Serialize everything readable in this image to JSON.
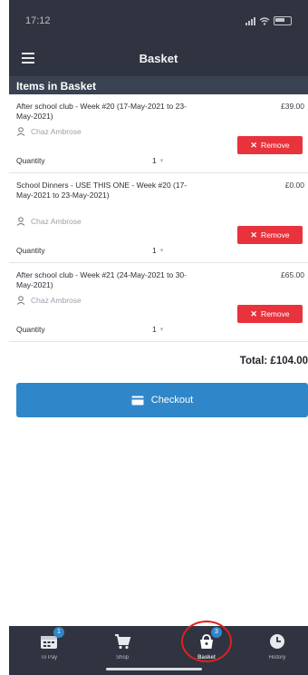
{
  "status": {
    "time": "17:12"
  },
  "navbar": {
    "title": "Basket"
  },
  "section": {
    "title": "Items in Basket"
  },
  "items": [
    {
      "title": "After school club - Week #20 (17-May-2021 to 23-May-2021)",
      "price": "£39.00",
      "person": "Chaz Ambrose",
      "remove_label": "Remove",
      "quantity_label": "Quantity",
      "quantity_value": "1"
    },
    {
      "title": "School Dinners - USE THIS ONE - Week #20 (17-May-2021 to 23-May-2021)",
      "price": "£0.00",
      "person": "Chaz Ambrose",
      "remove_label": "Remove",
      "quantity_label": "Quantity",
      "quantity_value": "1"
    },
    {
      "title": "After school club - Week #21 (24-May-2021 to 30-May-2021)",
      "price": "£65.00",
      "person": "Chaz Ambrose",
      "remove_label": "Remove",
      "quantity_label": "Quantity",
      "quantity_value": "1"
    }
  ],
  "total": "Total: £104.00",
  "checkout_label": "Checkout",
  "tabs": [
    {
      "label": "To Pay",
      "badge": "1",
      "icon": "calendar-icon"
    },
    {
      "label": "Shop",
      "badge": "",
      "icon": "cart-icon"
    },
    {
      "label": "Basket",
      "badge": "3",
      "icon": "basket-icon"
    },
    {
      "label": "History",
      "badge": "",
      "icon": "clock-icon"
    }
  ],
  "colors": {
    "header": "#2f3440",
    "accent": "#2f86c8",
    "remove": "#e8323c",
    "annotation": "#e02020"
  }
}
